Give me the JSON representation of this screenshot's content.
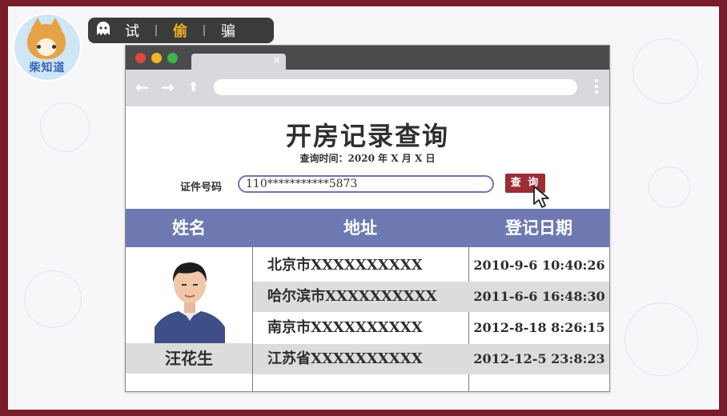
{
  "brand": {
    "badge_text": "柴知道",
    "banner_words": [
      "试",
      "偷",
      "骗"
    ],
    "banner_separator": "|"
  },
  "browser": {
    "tab_close": "×",
    "nav": {
      "back": "←",
      "forward": "→",
      "home": "⬆"
    }
  },
  "page": {
    "title": "开房记录查询",
    "query_time": "查询时间：2020 年 X 月  X 日",
    "id_label": "证件号码",
    "id_value": "110***********5873",
    "query_button": "查 询"
  },
  "table": {
    "headers": [
      "姓名",
      "地址",
      "登记日期"
    ],
    "person_name": "汪花生",
    "rows": [
      {
        "address": "北京市XXXXXXXXXX",
        "date": "2010-9-6 10:40:26"
      },
      {
        "address": "哈尔滨市XXXXXXXXXX",
        "date": "2011-6-6 16:48:30"
      },
      {
        "address": "南京市XXXXXXXXXX",
        "date": "2012-8-18  8:26:15"
      },
      {
        "address": "江苏省XXXXXXXXXX",
        "date": "2012-12-5  23:8:23"
      }
    ]
  },
  "colors": {
    "frame": "#7a1c2a",
    "header_bg": "#6e79b1",
    "button_bg": "#9b2d33",
    "titlebar": "#4b4b4b",
    "highlight_word": "#f2b41f"
  }
}
